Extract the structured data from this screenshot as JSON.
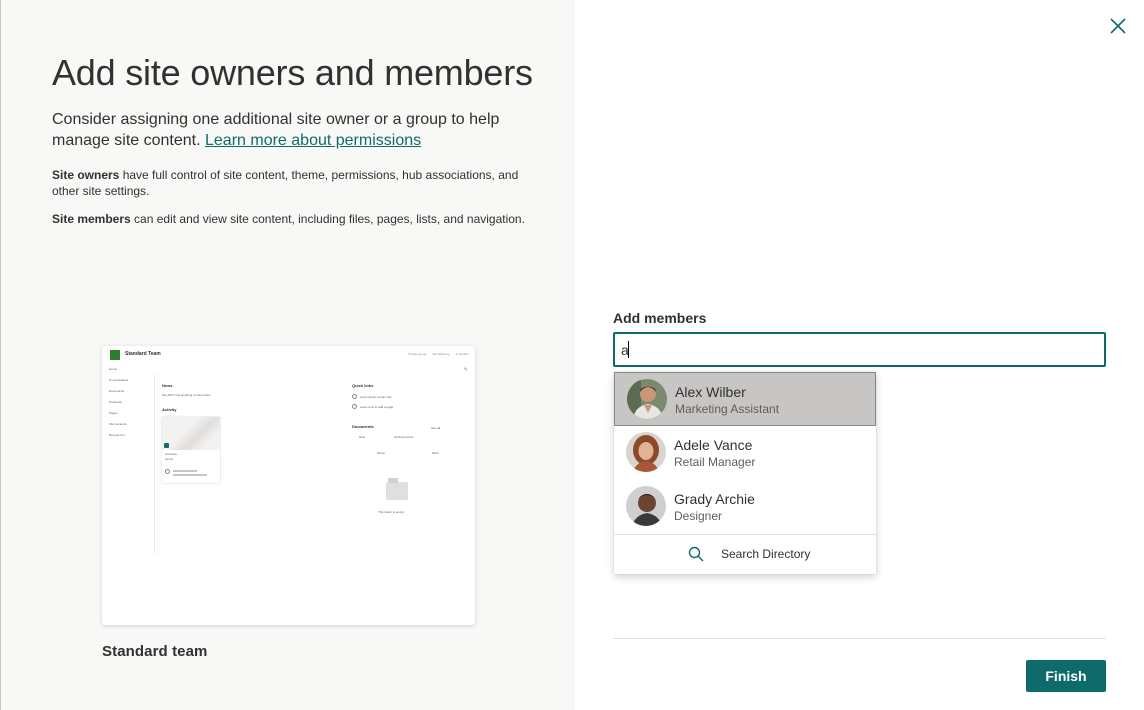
{
  "left": {
    "title": "Add site owners and members",
    "intro_text": "Consider assigning one additional site owner or a group to help manage site content.",
    "learn_more_link": "Learn more about permissions",
    "owners_bold": "Site owners",
    "owners_text": " have full control of site content, theme, permissions, hub associations, and other site settings.",
    "members_bold": "Site members",
    "members_text": " can edit and view site content, including files, pages, lists, and navigation.",
    "template_name": "Standard team"
  },
  "preview": {
    "site_name": "Standard Team",
    "top_actions": [
      "Private group",
      "Not following",
      "1 member"
    ],
    "nav_items": [
      "Home",
      "Conversations",
      "Documents",
      "Notebook",
      "Pages",
      "Site contents",
      "Recycle bin"
    ],
    "news_title": "News",
    "news_text": "We didn't find anything to show here.",
    "activity_title": "Activity",
    "activity_card_label": "OneNote",
    "activity_card_sub": "Home",
    "quick_links_title": "Quick links",
    "quick_links": [
      "Learn about a team site",
      "Learn how to add a page"
    ],
    "documents_title": "Documents",
    "documents_see_all": "See all",
    "documents_toolbar": [
      "New",
      "All Documents"
    ],
    "documents_cols": [
      "Name",
      "Modi"
    ],
    "folder_empty": "This folder is empty"
  },
  "right": {
    "close_icon": "close-icon",
    "add_members_label": "Add members",
    "input_value": "a",
    "suggestions": [
      {
        "name": "Alex Wilber",
        "title": "Marketing Assistant"
      },
      {
        "name": "Adele Vance",
        "title": "Retail Manager"
      },
      {
        "name": "Grady Archie",
        "title": "Designer"
      }
    ],
    "search_directory_label": "Search Directory",
    "finish_label": "Finish"
  },
  "colors": {
    "accent": "#0f6b6b",
    "left_bg": "#f8f8f7",
    "selected_row": "#c8c6c4"
  }
}
